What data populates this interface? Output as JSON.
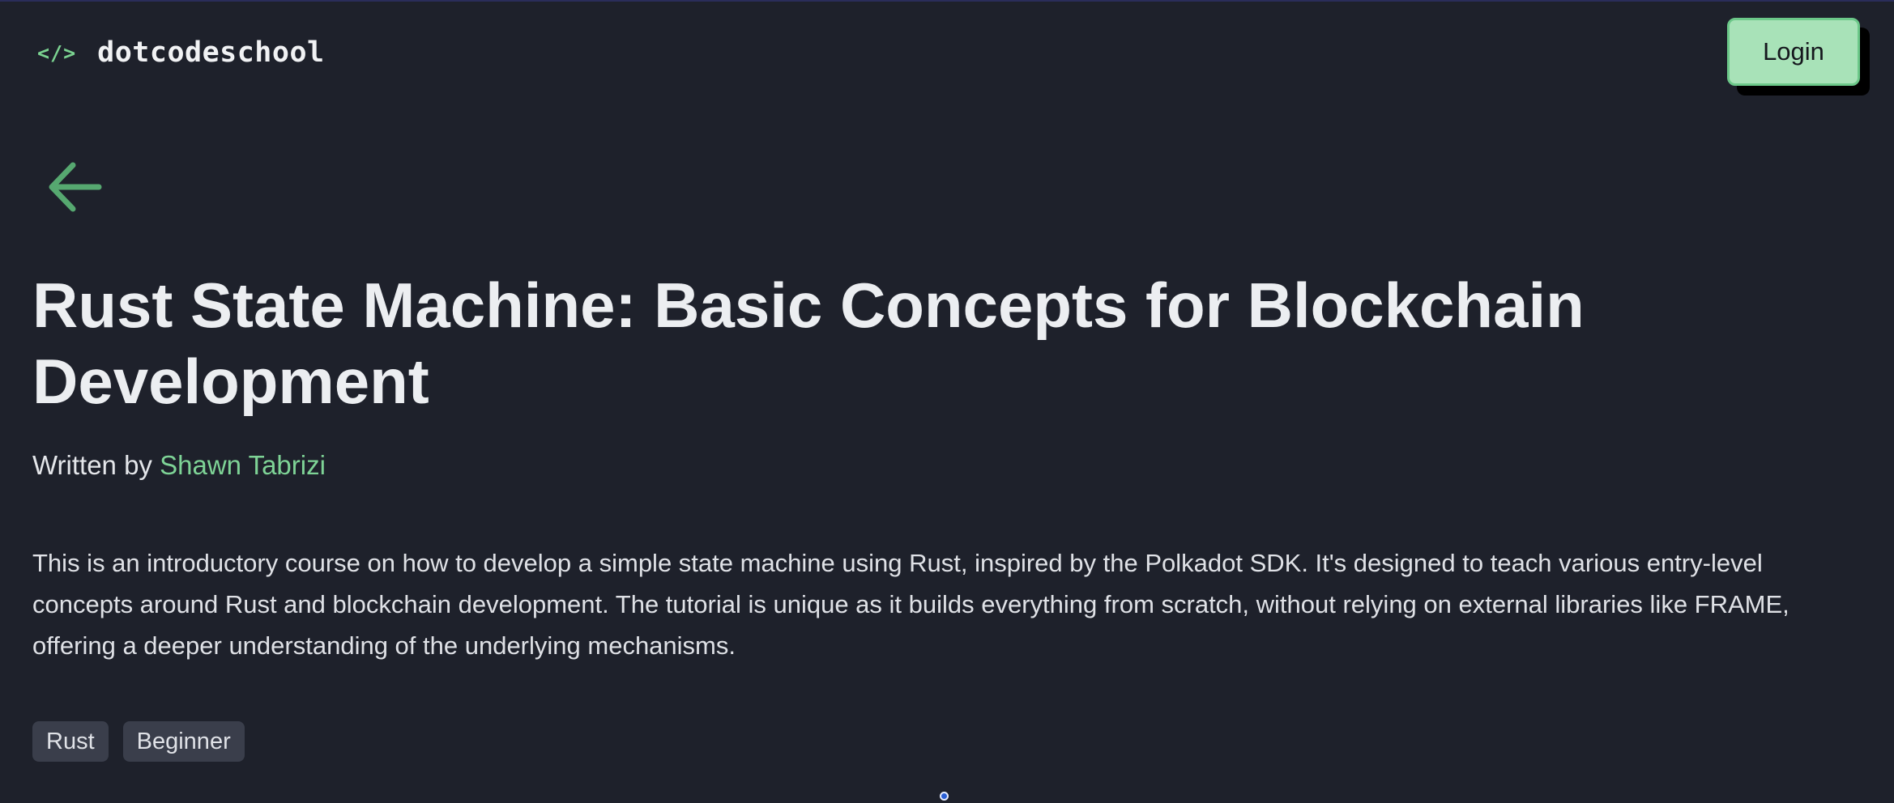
{
  "header": {
    "logo_mark": "</>",
    "logo_text": "dotcodeschool",
    "login_label": "Login"
  },
  "course": {
    "title": "Rust State Machine: Basic Concepts for Blockchain Development",
    "byline_prefix": "Written by ",
    "author": "Shawn Tabrizi",
    "description": "This is an introductory course on how to develop a simple state machine using Rust, inspired by the Polkadot SDK. It's designed to teach various entry-level concepts around Rust and blockchain development. The tutorial is unique as it builds everything from scratch, without relying on external libraries like FRAME, offering a deeper understanding of the underlying mechanisms.",
    "tags": [
      "Rust",
      "Beginner"
    ]
  },
  "icons": {
    "back": "arrow-left-icon"
  },
  "colors": {
    "background": "#1e212b",
    "accent_green": "#7ed396",
    "login_bg": "#a8e2b8",
    "tag_bg": "#3a3e4b"
  }
}
